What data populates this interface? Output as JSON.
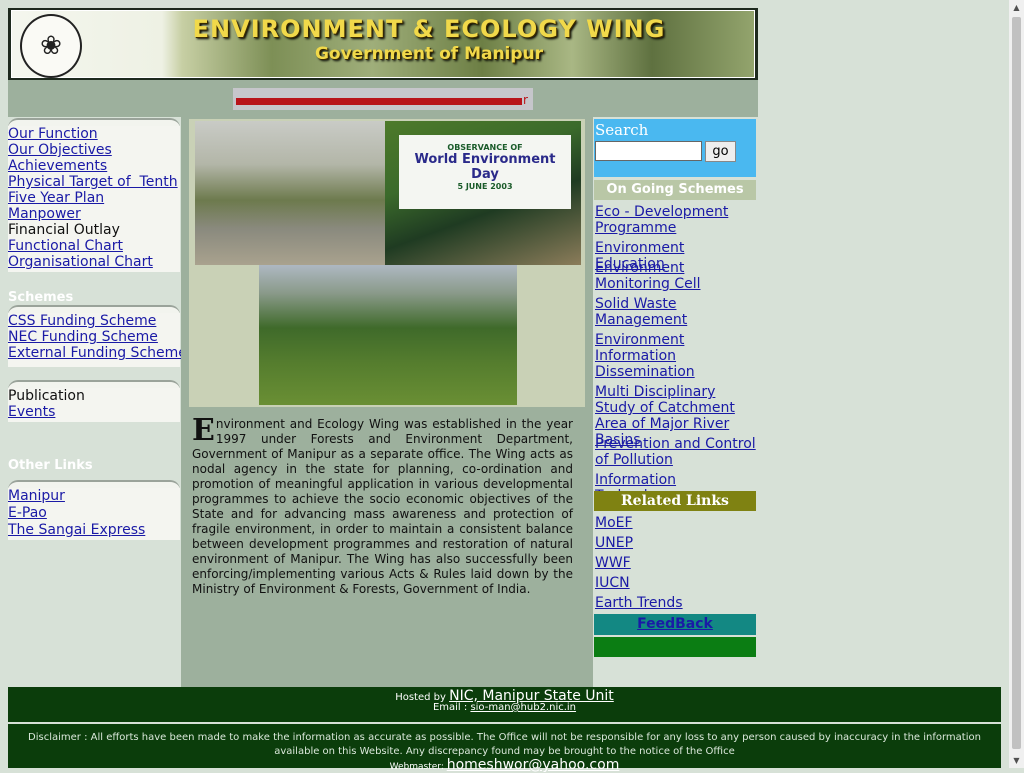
{
  "header": {
    "title": "ENVIRONMENT & ECOLOGY WING",
    "subtitle": "Government of Manipur"
  },
  "ticker": {
    "text": "r"
  },
  "leftnav": {
    "main_items": [
      {
        "label": "Our Function",
        "link": true
      },
      {
        "label": "Our Objectives",
        "link": true
      },
      {
        "label": "Achievements",
        "link": true
      },
      {
        "label": "Physical Target of  Tenth",
        "link": true
      },
      {
        "label": "Five Year Plan",
        "link": true
      },
      {
        "label": "Manpower",
        "link": true
      },
      {
        "label": "Financial Outlay",
        "link": false
      },
      {
        "label": "Functional Chart",
        "link": true
      },
      {
        "label": "Organisational Chart",
        "link": true
      }
    ],
    "schemes_heading": "Schemes",
    "schemes": [
      "CSS Funding Scheme",
      "NEC Funding Scheme",
      "External Funding Scheme"
    ],
    "misc": [
      {
        "label": "Publication",
        "link": false
      },
      {
        "label": "Events",
        "link": true
      }
    ],
    "other_links_heading": "Other Links",
    "other_links": [
      "Manipur",
      "E-Pao",
      "The Sangai Express"
    ]
  },
  "photos": {
    "banner_line1": "OBSERVANCE OF",
    "banner_line2": "World Environment Day",
    "banner_line3": "5 JUNE 2003"
  },
  "intro": {
    "dropcap": "E",
    "text": "nvironment and Ecology Wing was established in the year 1997 under Forests and Environment Department, Government of Manipur as a separate office. The Wing acts as nodal agency in the state for planning, co-ordination and promotion of meaningful application in various developmental programmes to achieve the socio economic objectives of the State and for advancing mass awareness and protection of fragile environment, in order to maintain a consistent balance between development programmes and restoration of natural environment of Manipur. The Wing has also successfully been enforcing/implementing various Acts & Rules laid down by the Ministry of Environment & Forests, Government of India."
  },
  "search": {
    "label": "Search",
    "value": "",
    "button": "go"
  },
  "ongoing": {
    "heading": "On Going Schemes",
    "items": [
      "Eco - Development Programme",
      "Environment Education",
      "Environment Monitoring Cell",
      "Solid Waste Management",
      "Environment Information Dissemination",
      "Multi Disciplinary Study of Catchment Area of Major River Basins",
      "Prevention and Control of Pollution",
      "Information Technology"
    ]
  },
  "related": {
    "heading": "Related Links",
    "items": [
      "MoEF",
      "UNEP",
      "WWF",
      "IUCN",
      "Earth Trends"
    ]
  },
  "feedback": {
    "label": "FeedBack"
  },
  "footer": {
    "hosted_prefix": "Hosted by ",
    "hosted_link": "NIC, Manipur State Unit",
    "email_prefix": "Email : ",
    "email": "sio-man@hub2.nic.in",
    "disclaimer": "Disclaimer : All efforts have been made to make the information as accurate as possible. The Office will not be responsible for any loss to any person caused by inaccuracy in the information available on this Website. Any discrepancy found may be brought to the notice of the Office",
    "webmaster_prefix": "Webmaster: ",
    "webmaster": "homeshwor@yahoo.com"
  },
  "colors": {
    "page_bg": "#d7e1d7",
    "link": "#1a1aa6",
    "footer_bg": "#0b3d0b",
    "search_bg": "#4ab8f0",
    "feedback_bg": "#138883",
    "related_bg": "#7f8212"
  },
  "icons": {
    "logo": "sangai-deer-emblem-icon",
    "scroll_up": "triangle-up-icon",
    "scroll_down": "triangle-down-icon"
  }
}
